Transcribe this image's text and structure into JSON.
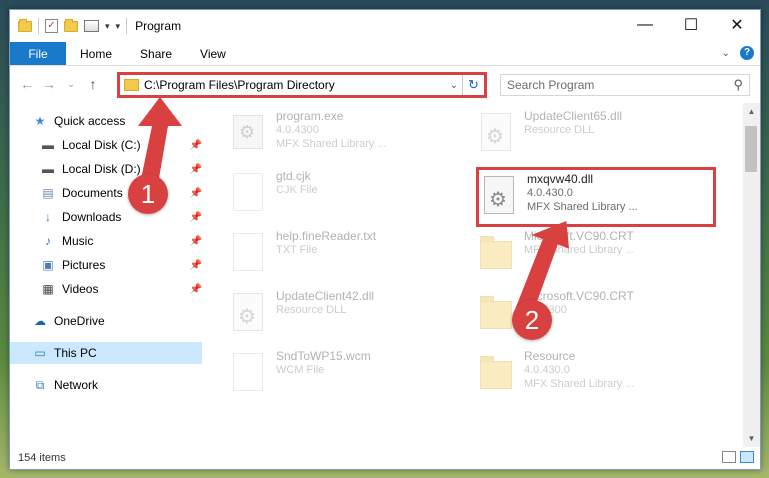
{
  "window": {
    "title": "Program",
    "controls": {
      "minimize": "—",
      "maximize": "☐",
      "close": "✕"
    }
  },
  "ribbon": {
    "tabs": [
      "File",
      "Home",
      "Share",
      "View"
    ],
    "help": "?"
  },
  "address": {
    "path": "C:\\Program Files\\Program Directory",
    "search_placeholder": "Search Program"
  },
  "nav": {
    "items": [
      {
        "label": "Quick access",
        "icon": "star-icon",
        "pinned": false
      },
      {
        "label": "Local Disk (C:)",
        "icon": "drive-icon",
        "pinned": true
      },
      {
        "label": "Local Disk (D:)",
        "icon": "drive-icon",
        "pinned": true
      },
      {
        "label": "Documents",
        "icon": "documents-icon",
        "pinned": true
      },
      {
        "label": "Downloads",
        "icon": "downloads-icon",
        "pinned": true
      },
      {
        "label": "Music",
        "icon": "music-icon",
        "pinned": true
      },
      {
        "label": "Pictures",
        "icon": "pictures-icon",
        "pinned": true
      },
      {
        "label": "Videos",
        "icon": "videos-icon",
        "pinned": true
      },
      {
        "label": "OneDrive",
        "icon": "cloud-icon",
        "pinned": false
      },
      {
        "label": "This PC",
        "icon": "computer-icon",
        "pinned": false,
        "selected": true
      },
      {
        "label": "Network",
        "icon": "network-icon",
        "pinned": false
      }
    ]
  },
  "files": [
    {
      "name": "program.exe",
      "type": "4.0.4300",
      "desc": "MFX Shared Library ...",
      "icon": "exe-icon",
      "faded": true
    },
    {
      "name": "UpdateClient65.dll",
      "type": "Resource DLL",
      "desc": "",
      "icon": "dll-icon",
      "faded": true
    },
    {
      "name": "gtd.cjk",
      "type": "CJK File",
      "desc": "",
      "icon": "document-icon",
      "faded": true
    },
    {
      "name": "mxqvw40.dll",
      "type": "4.0.430.0",
      "desc": "MFX Shared Library ...",
      "icon": "dll-icon",
      "faded": false,
      "highlighted": true
    },
    {
      "name": "help.fineReader.txt",
      "type": "TXT File",
      "desc": "",
      "icon": "document-icon",
      "faded": true
    },
    {
      "name": "Microsoft.VC90.CRT",
      "type": "",
      "desc": "MFX Shared Library ...",
      "icon": "folder-icon",
      "faded": true
    },
    {
      "name": "UpdateClient42.dll",
      "type": "Resource DLL",
      "desc": "",
      "icon": "dll-icon",
      "faded": true
    },
    {
      "name": "Microsoft.VC90.CRT",
      "type": "4.0.4300",
      "desc": "",
      "icon": "folder-icon",
      "faded": true
    },
    {
      "name": "SndToWP15.wcm",
      "type": "WCM File",
      "desc": "",
      "icon": "document-icon",
      "faded": true
    },
    {
      "name": "Resource",
      "type": "4.0.430.0",
      "desc": "MFX Shared Library ...",
      "icon": "folder-icon",
      "faded": true
    }
  ],
  "status": {
    "count": "154 items"
  },
  "annotations": {
    "step1": "1",
    "step2": "2",
    "color": "#d94040"
  }
}
